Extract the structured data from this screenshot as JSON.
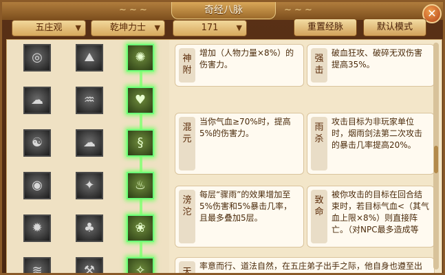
{
  "window": {
    "title": "奇经八脉",
    "close_label": "✕"
  },
  "toolbar": {
    "dropdowns": [
      "五庄观",
      "乾坤力士",
      "171"
    ],
    "reset_label": "重置经脉",
    "default_label": "默认模式"
  },
  "cards": [
    {
      "name": "神附",
      "desc": "增加（人物力量×8%）的伤害力。"
    },
    {
      "name": "强击",
      "desc": "破血狂攻、破碎无双伤害提高35%。"
    },
    {
      "name": "混元",
      "desc": "当你气血≥70%时，提高5%的伤害力。"
    },
    {
      "name": "雨杀",
      "desc": "攻击目标为非玩家单位时，烟雨剑法第二次攻击的暴击几率提高20%。"
    },
    {
      "name": "滂沱",
      "desc": "每层“骤雨”的效果增加至5%伤害和5%暴击几率，且最多叠加5层。"
    },
    {
      "name": "致命",
      "desc": "被你攻击的目标在回合结束时，若目标气血<（其气血上限×8%）则直接阵亡。（对NPC最多造成等"
    },
    {
      "name": "天",
      "desc": "率意而行、道法自然，在五庄弟子出手之际，他自身也遵至出道，扣字由持令者的小剑意，或流"
    }
  ],
  "icons": {
    "col1": [
      "kettle-icon",
      "thunder-icon",
      "taiji-icon",
      "yinyang-icon",
      "sun-icon",
      "wave-icon"
    ],
    "col2": [
      "mountain-icon",
      "dragon-icon",
      "cloud-icon",
      "sword-icon",
      "tree-icon",
      "hammer-icon"
    ],
    "col3": [
      "rays-icon",
      "heart-icon",
      "snake-icon",
      "gourd-icon",
      "lotus-icon",
      "spirit-icon"
    ]
  }
}
